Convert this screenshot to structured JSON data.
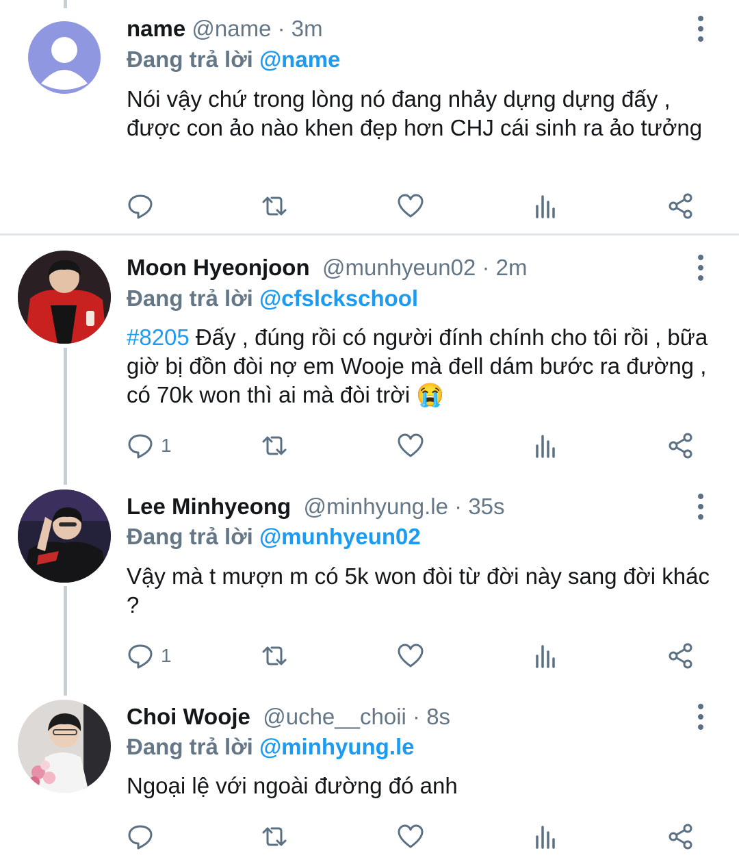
{
  "colors": {
    "link": "#1d9bf0",
    "secondary": "#657786",
    "icon": "#5b7083",
    "thread_line": "#c4cfd6"
  },
  "icons": {
    "reply": "reply-icon",
    "retweet": "retweet-icon",
    "like": "like-icon",
    "views": "views-icon",
    "share": "share-icon",
    "more": "more-icon"
  },
  "tweets": [
    {
      "name": "name",
      "handle": "@name",
      "separator": "·",
      "time": "3m",
      "reply_prefix": "Đang trả lời",
      "reply_to": "@name",
      "text": "Nói vậy chứ trong lòng nó đang nhảy dựng dựng đấy , được con ảo nào khen đẹp hơn CHJ cái sinh ra ảo tưởng",
      "reply_count": ""
    },
    {
      "name": "Moon Hyeonjoon",
      "handle": "@munhyeun02",
      "separator": "·",
      "time": "2m",
      "reply_prefix": "Đang trả lời",
      "reply_to": "@cfslckschool",
      "hashtag": "#8205",
      "text": " Đấy , đúng rồi có người đính chính cho tôi rồi , bữa giờ bị đồn đòi nợ em Wooje mà đell dám bước ra đường , có 70k won thì ai mà đòi trời 😭",
      "reply_count": "1"
    },
    {
      "name": "Lee Minhyeong",
      "handle": "@minhyung.le",
      "separator": "·",
      "time": "35s",
      "reply_prefix": "Đang trả lời",
      "reply_to": "@munhyeun02",
      "text": "Vậy mà t mượn m có 5k won đòi từ đời này sang đời khác ?",
      "reply_count": "1"
    },
    {
      "name": "Choi Wooje",
      "handle": "@uche__choii",
      "separator": "·",
      "time": "8s",
      "reply_prefix": "Đang trả lời",
      "reply_to": "@minhyung.le",
      "text": "Ngoại lệ với ngoài đường đó anh",
      "reply_count": ""
    }
  ]
}
